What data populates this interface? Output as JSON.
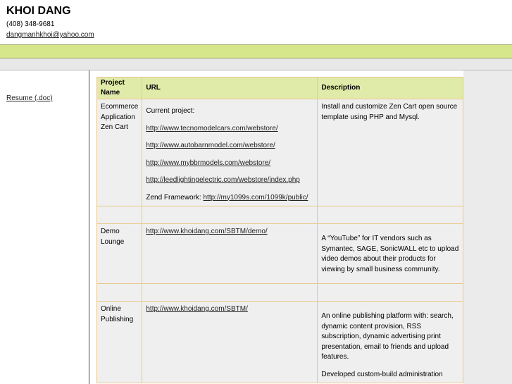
{
  "header": {
    "name": "KHOI DANG",
    "phone": "(408) 348-9681",
    "email": "dangmanhkhoi@yahoo.com"
  },
  "sidebar": {
    "resume_link": "Resume (.doc)"
  },
  "table": {
    "headers": [
      "Project Name",
      "URL",
      "Description"
    ],
    "rows": [
      {
        "name": "Ecommerce Application Zen Cart",
        "current_label": "Current project:",
        "urls": [
          "http://www.tecnomodelcars.com/webstore/",
          "http://www.autobarnmodel.com/webstore/",
          "http://www.mybbrmodels.com/webstore/",
          "http://leedlightingelectric.com/webstore/index.php"
        ],
        "zend_label": "Zend Framework:",
        "zend_url": "http://my1099s.com/1099k/public/",
        "description": "Install and customize Zen Cart open source template using PHP and Mysql."
      },
      {
        "name": "Demo Lounge",
        "url": "http://www.khoidang.com/SBTM/demo/",
        "description": "A “YouTube” for IT vendors such as Symantec, SAGE, SonicWALL etc to upload video demos about their products for viewing by small business community."
      },
      {
        "name": "Online Publishing",
        "url": "http://www.khoidang.com/SBTM/",
        "description": "An online publishing platform with: search, dynamic content provision, RSS subscription, dynamic advertising print presentation, email to friends and upload features.",
        "description_more": "Developed custom-build administration"
      }
    ]
  }
}
